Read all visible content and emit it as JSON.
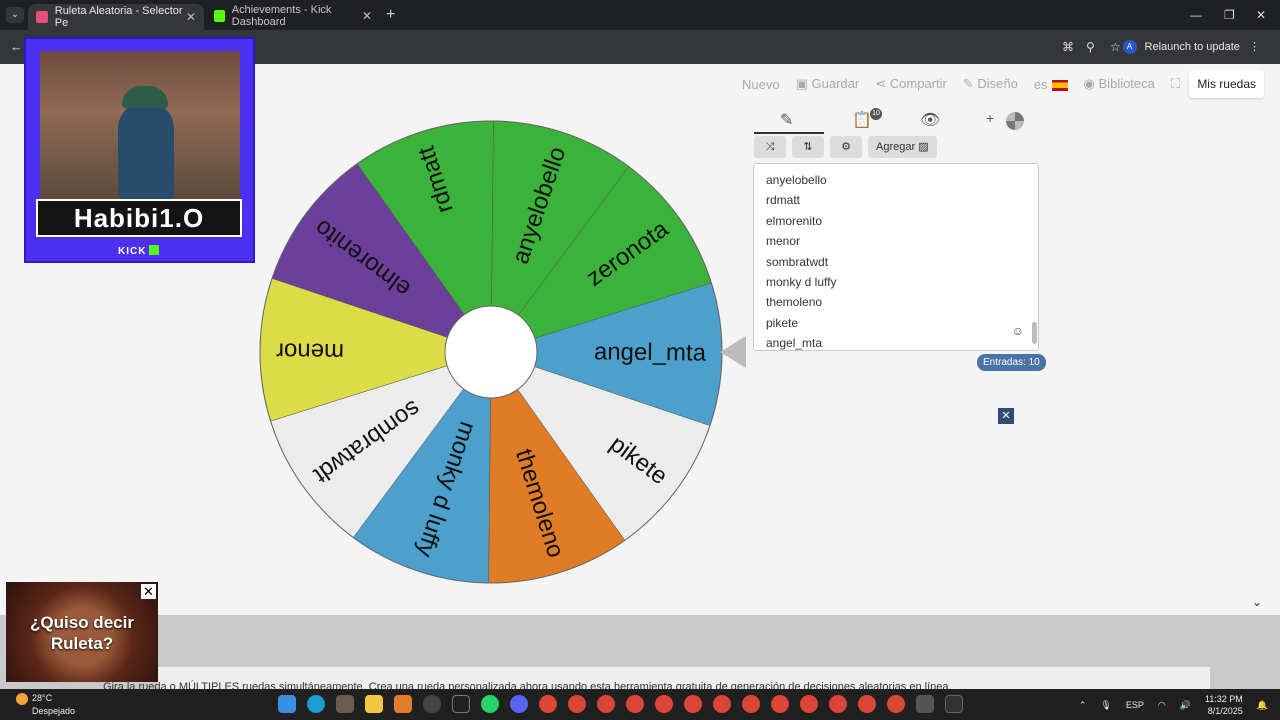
{
  "browser": {
    "tabs": [
      {
        "title": "Ruleta Aleatoria - Selector Pe",
        "active": true,
        "favicon_color": "#e34f7a"
      },
      {
        "title": "Achievements - Kick Dashboard",
        "active": false,
        "favicon_color": "#53fc18"
      }
    ],
    "relaunch_label": "Relaunch to update",
    "avatar_letter": "A"
  },
  "nav": {
    "nuevo": "Nuevo",
    "guardar": "Guardar",
    "compartir": "Compartir",
    "diseno": "Diseño",
    "lang": "es",
    "biblioteca": "Biblioteca",
    "mis_ruedas": "Mis ruedas"
  },
  "wheel": {
    "segments": [
      {
        "label": "anyelobello",
        "color": "#3bb33b"
      },
      {
        "label": "zeronota",
        "color": "#3bb33b"
      },
      {
        "label": "angel_mta",
        "color": "#4d9fcc"
      },
      {
        "label": "pikete",
        "color": "#ececec"
      },
      {
        "label": "themoleno",
        "color": "#e07c25"
      },
      {
        "label": "monky d luffy",
        "color": "#4d9fcc"
      },
      {
        "label": "sombratwdt",
        "color": "#ececec"
      },
      {
        "label": "menor",
        "color": "#dcdc47"
      },
      {
        "label": "elmorenito",
        "color": "#6b3f9a"
      },
      {
        "label": "rdmatt",
        "color": "#3bb33b"
      }
    ]
  },
  "panel": {
    "entries_badge": "10",
    "agregar_label": "Agregar",
    "entries": [
      "anyelobello",
      "rdmatt",
      "elmorenito",
      "menor",
      "sombratwdt",
      "monky d luffy",
      "themoleno",
      "pikete",
      "angel_mta"
    ],
    "count_label": "Entradas: 10"
  },
  "footer": {
    "text": "Gira la rueda o MÚLTIPLES ruedas simultáneamente. Crea una rueda personalizada ahora usando esta herramienta gratuita de generación de decisiones aleatorias en línea."
  },
  "overlay": {
    "streamer_name": "Habibi1.O",
    "platform": "KICK",
    "ad_text": "¿Quiso decir Ruleta?"
  },
  "taskbar": {
    "temperature": "28°C",
    "weather": "Despejado",
    "lang": "ESP",
    "time": "11:32 PM",
    "date": "8/1/2025"
  }
}
